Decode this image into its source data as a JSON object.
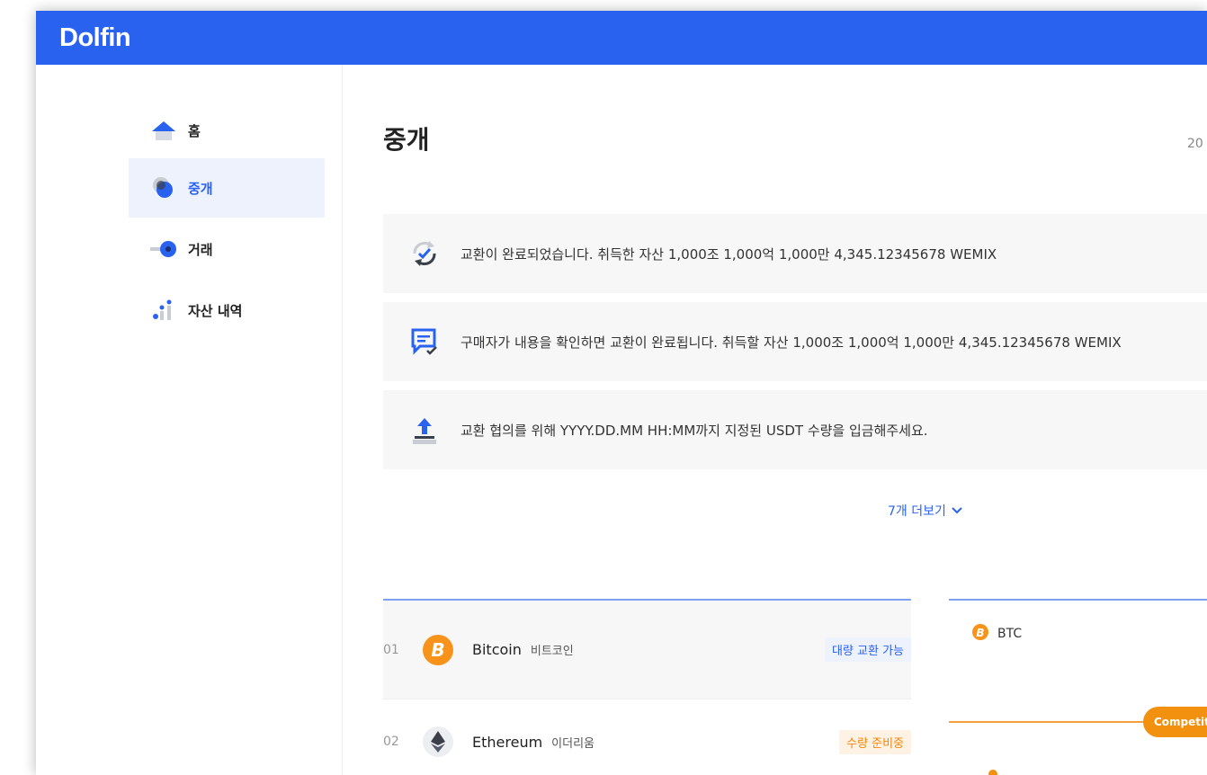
{
  "app": {
    "logo": "Dolfin",
    "brand_color": "#2a62f0"
  },
  "sidebar": {
    "items": [
      {
        "label": "홈",
        "icon": "home-icon",
        "active": false
      },
      {
        "label": "중개",
        "icon": "brokerage-icon",
        "active": true
      },
      {
        "label": "거래",
        "icon": "trade-icon",
        "active": false
      },
      {
        "label": "자산 내역",
        "icon": "asset-history-icon",
        "active": false
      }
    ]
  },
  "main": {
    "title": "중개",
    "date_stub": "20",
    "notices": [
      {
        "icon": "exchange-complete-icon",
        "text": "교환이 완료되었습니다. 취득한 자산 1,000조 1,000억 1,000만 4,345.12345678 WEMIX"
      },
      {
        "icon": "confirm-message-icon",
        "text": "구매자가 내용을 확인하면 교환이 완료됩니다. 취득할 자산 1,000조 1,000억 1,000만 4,345.12345678 WEMIX"
      },
      {
        "icon": "upload-icon",
        "text": "교환 협의를 위해 YYYY.DD.MM HH:MM까지 지정된 USDT 수량을 입금해주세요."
      }
    ],
    "more_label": "7개 더보기"
  },
  "coins": [
    {
      "rank": "01",
      "name": "Bitcoin",
      "kor": "비트코인",
      "badge": "대량 교환 가능",
      "badge_color": "blue",
      "icon": "bitcoin-icon"
    },
    {
      "rank": "02",
      "name": "Ethereum",
      "kor": "이더리움",
      "badge": "수량 준비중",
      "badge_color": "orange",
      "icon": "ethereum-icon"
    }
  ],
  "btc_panel": {
    "symbol": "BTC",
    "pill": "Competit"
  }
}
